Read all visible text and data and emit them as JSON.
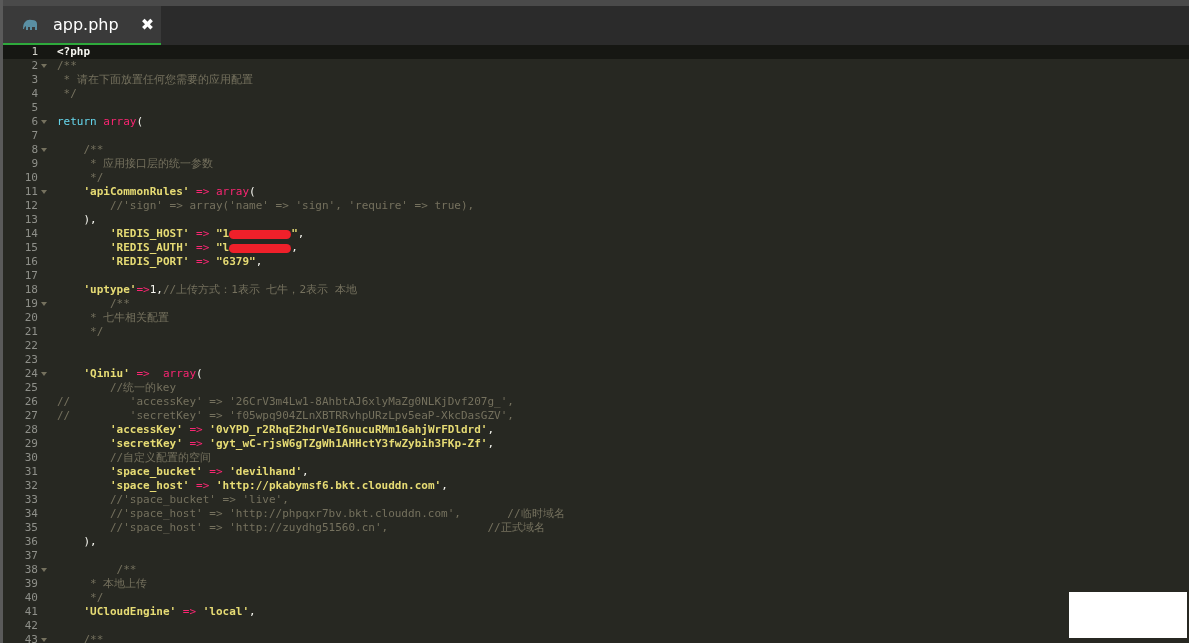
{
  "tabs": [
    {
      "label": "app.php",
      "close": "✖",
      "selected": true
    }
  ],
  "lines": [
    {
      "number": "1",
      "foldable": false,
      "current": true,
      "tokens": [
        {
          "kind": "tag",
          "text": "<?php"
        }
      ]
    },
    {
      "number": "2",
      "foldable": true,
      "current": false,
      "tokens": [
        {
          "kind": "comment",
          "text": "/**"
        }
      ]
    },
    {
      "number": "3",
      "foldable": false,
      "current": false,
      "tokens": [
        {
          "kind": "comment",
          "text": " * 请在下面放置任何您需要的应用配置"
        }
      ]
    },
    {
      "number": "4",
      "foldable": false,
      "current": false,
      "tokens": [
        {
          "kind": "comment",
          "text": " */"
        }
      ]
    },
    {
      "number": "5",
      "foldable": false,
      "current": false
    },
    {
      "number": "6",
      "foldable": true,
      "current": false,
      "tokens": [
        {
          "kind": "keyword",
          "text": "return "
        },
        {
          "kind": "func",
          "text": "array"
        },
        {
          "kind": "plain",
          "text": "("
        }
      ]
    },
    {
      "number": "7",
      "foldable": false,
      "current": false
    },
    {
      "number": "8",
      "foldable": true,
      "current": false,
      "tokens": [
        {
          "kind": "comment",
          "text": "    /**"
        }
      ]
    },
    {
      "number": "9",
      "foldable": false,
      "current": false,
      "tokens": [
        {
          "kind": "comment",
          "text": "     * 应用接口层的统一参数"
        }
      ]
    },
    {
      "number": "10",
      "foldable": false,
      "current": false,
      "tokens": [
        {
          "kind": "comment",
          "text": "     */"
        }
      ]
    },
    {
      "number": "11",
      "foldable": true,
      "current": false,
      "tokens": [
        {
          "kind": "string",
          "text": "    'apiCommonRules'"
        },
        {
          "kind": "op",
          "text": " => "
        },
        {
          "kind": "func",
          "text": "array"
        },
        {
          "kind": "plain",
          "text": "("
        }
      ]
    },
    {
      "number": "12",
      "foldable": false,
      "current": false,
      "tokens": [
        {
          "kind": "comment",
          "text": "        //'sign' => array('name' => 'sign', 'require' => true),"
        }
      ]
    },
    {
      "number": "13",
      "foldable": false,
      "current": false,
      "tokens": [
        {
          "kind": "plain",
          "text": "    ),"
        }
      ]
    },
    {
      "number": "14",
      "foldable": false,
      "current": false,
      "tokens": [
        {
          "kind": "string",
          "text": "        'REDIS_HOST'"
        },
        {
          "kind": "op",
          "text": " => "
        },
        {
          "kind": "string",
          "text": "\"1"
        },
        {
          "kind": "redacted"
        },
        {
          "kind": "string",
          "text": "\""
        },
        {
          "kind": "plain",
          "text": ","
        }
      ]
    },
    {
      "number": "15",
      "foldable": false,
      "current": false,
      "tokens": [
        {
          "kind": "string",
          "text": "        'REDIS_AUTH'"
        },
        {
          "kind": "op",
          "text": " => "
        },
        {
          "kind": "string",
          "text": "\"l"
        },
        {
          "kind": "redacted"
        },
        {
          "kind": "plain",
          "text": ","
        }
      ]
    },
    {
      "number": "16",
      "foldable": false,
      "current": false,
      "tokens": [
        {
          "kind": "string",
          "text": "        'REDIS_PORT'"
        },
        {
          "kind": "op",
          "text": " => "
        },
        {
          "kind": "string",
          "text": "\"6379\""
        },
        {
          "kind": "plain",
          "text": ","
        }
      ]
    },
    {
      "number": "17",
      "foldable": false,
      "current": false
    },
    {
      "number": "18",
      "foldable": false,
      "current": false,
      "tokens": [
        {
          "kind": "string",
          "text": "    'uptype'"
        },
        {
          "kind": "op",
          "text": "=>"
        },
        {
          "kind": "plain",
          "text": "1,"
        },
        {
          "kind": "comment",
          "text": "//上传方式：1表示 七牛，2表示 本地"
        }
      ]
    },
    {
      "number": "19",
      "foldable": true,
      "current": false,
      "tokens": [
        {
          "kind": "comment",
          "text": "        /**"
        }
      ]
    },
    {
      "number": "20",
      "foldable": false,
      "current": false,
      "tokens": [
        {
          "kind": "comment",
          "text": "     * 七牛相关配置"
        }
      ]
    },
    {
      "number": "21",
      "foldable": false,
      "current": false,
      "tokens": [
        {
          "kind": "comment",
          "text": "     */"
        }
      ]
    },
    {
      "number": "22",
      "foldable": false,
      "current": false
    },
    {
      "number": "23",
      "foldable": false,
      "current": false
    },
    {
      "number": "24",
      "foldable": true,
      "current": false,
      "tokens": [
        {
          "kind": "string",
          "text": "    'Qiniu'"
        },
        {
          "kind": "op",
          "text": " =>  "
        },
        {
          "kind": "func",
          "text": "array"
        },
        {
          "kind": "plain",
          "text": "("
        }
      ]
    },
    {
      "number": "25",
      "foldable": false,
      "current": false,
      "tokens": [
        {
          "kind": "comment",
          "text": "        //统一的key"
        }
      ]
    },
    {
      "number": "26",
      "foldable": false,
      "current": false,
      "tokens": [
        {
          "kind": "comment",
          "text": "//         'accessKey' => '26CrV3m4Lw1-8AhbtAJ6xlyMaZg0NLKjDvf207g_',"
        }
      ]
    },
    {
      "number": "27",
      "foldable": false,
      "current": false,
      "tokens": [
        {
          "kind": "comment",
          "text": "//         'secretKey' => 'f05wpq904ZLnXBTRRvhpURzLpv5eaP-XkcDasGZV',"
        }
      ]
    },
    {
      "number": "28",
      "foldable": false,
      "current": false,
      "tokens": [
        {
          "kind": "string",
          "text": "        'accessKey'"
        },
        {
          "kind": "op",
          "text": " => "
        },
        {
          "kind": "string",
          "text": "'0vYPD_r2RhqE2hdrVeI6nucuRMm16ahjWrFDldrd'"
        },
        {
          "kind": "plain",
          "text": ","
        }
      ]
    },
    {
      "number": "29",
      "foldable": false,
      "current": false,
      "tokens": [
        {
          "kind": "string",
          "text": "        'secretKey'"
        },
        {
          "kind": "op",
          "text": " => "
        },
        {
          "kind": "string",
          "text": "'gyt_wC-rjsW6gTZgWh1AHHctY3fwZybih3FKp-Zf'"
        },
        {
          "kind": "plain",
          "text": ","
        }
      ]
    },
    {
      "number": "30",
      "foldable": false,
      "current": false,
      "tokens": [
        {
          "kind": "comment",
          "text": "        //自定义配置的空间"
        }
      ]
    },
    {
      "number": "31",
      "foldable": false,
      "current": false,
      "tokens": [
        {
          "kind": "string",
          "text": "        'space_bucket'"
        },
        {
          "kind": "op",
          "text": " => "
        },
        {
          "kind": "string",
          "text": "'devilhand'"
        },
        {
          "kind": "plain",
          "text": ","
        }
      ]
    },
    {
      "number": "32",
      "foldable": false,
      "current": false,
      "tokens": [
        {
          "kind": "string",
          "text": "        'space_host'"
        },
        {
          "kind": "op",
          "text": " => "
        },
        {
          "kind": "string",
          "text": "'http://pkabymsf6.bkt.clouddn.com'"
        },
        {
          "kind": "plain",
          "text": ","
        }
      ]
    },
    {
      "number": "33",
      "foldable": false,
      "current": false,
      "tokens": [
        {
          "kind": "comment",
          "text": "        //'space_bucket' => 'live',"
        }
      ]
    },
    {
      "number": "34",
      "foldable": false,
      "current": false,
      "tokens": [
        {
          "kind": "comment",
          "text": "        //'space_host' => 'http://phpqxr7bv.bkt.clouddn.com',       //临时域名"
        }
      ]
    },
    {
      "number": "35",
      "foldable": false,
      "current": false,
      "tokens": [
        {
          "kind": "comment",
          "text": "        //'space_host' => 'http://zuydhg51560.cn',               //正式域名"
        }
      ]
    },
    {
      "number": "36",
      "foldable": false,
      "current": false,
      "tokens": [
        {
          "kind": "plain",
          "text": "    ),"
        }
      ]
    },
    {
      "number": "37",
      "foldable": false,
      "current": false
    },
    {
      "number": "38",
      "foldable": true,
      "current": false,
      "tokens": [
        {
          "kind": "comment",
          "text": "         /**"
        }
      ]
    },
    {
      "number": "39",
      "foldable": false,
      "current": false,
      "tokens": [
        {
          "kind": "comment",
          "text": "     * 本地上传"
        }
      ]
    },
    {
      "number": "40",
      "foldable": false,
      "current": false,
      "tokens": [
        {
          "kind": "comment",
          "text": "     */"
        }
      ]
    },
    {
      "number": "41",
      "foldable": false,
      "current": false,
      "tokens": [
        {
          "kind": "string",
          "text": "    'UCloudEngine'"
        },
        {
          "kind": "op",
          "text": " => "
        },
        {
          "kind": "string",
          "text": "'local'"
        },
        {
          "kind": "plain",
          "text": ","
        }
      ]
    },
    {
      "number": "42",
      "foldable": false,
      "current": false
    },
    {
      "number": "43",
      "foldable": true,
      "current": false,
      "tokens": [
        {
          "kind": "comment",
          "text": "    /**"
        }
      ]
    }
  ]
}
